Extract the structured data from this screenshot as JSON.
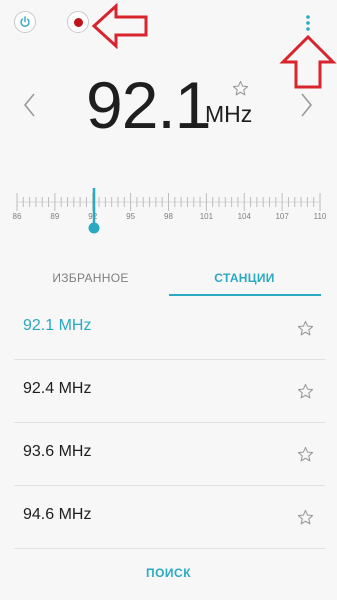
{
  "colors": {
    "accent": "#2aa9c2",
    "record_dot": "#c0141c",
    "annotation_arrow": "#d9232d",
    "text_primary": "#1e1e1e",
    "text_secondary": "#7f7f7f"
  },
  "toolbar": {
    "power_icon": "power-icon",
    "record_icon": "record-icon",
    "menu_icon": "more-vert-icon"
  },
  "tuner": {
    "frequency": "92.1",
    "unit": "MHz",
    "favorite_icon": "star-outline-icon",
    "prev_icon": "chevron-left-icon",
    "next_icon": "chevron-right-icon"
  },
  "scale": {
    "labels": [
      "86",
      "89",
      "92",
      "95",
      "98",
      "101",
      "104",
      "107",
      "110"
    ],
    "min": 86,
    "max": 110,
    "current": 92.1
  },
  "tabs": {
    "favorites": "ИЗБРАННОЕ",
    "stations": "СТАНЦИИ",
    "active": "stations"
  },
  "stations": [
    {
      "label": "92.1 MHz",
      "active": true
    },
    {
      "label": "92.4 MHz",
      "active": false
    },
    {
      "label": "93.6 MHz",
      "active": false
    },
    {
      "label": "94.6 MHz",
      "active": false
    }
  ],
  "footer": {
    "search_label": "ПОИСК"
  }
}
